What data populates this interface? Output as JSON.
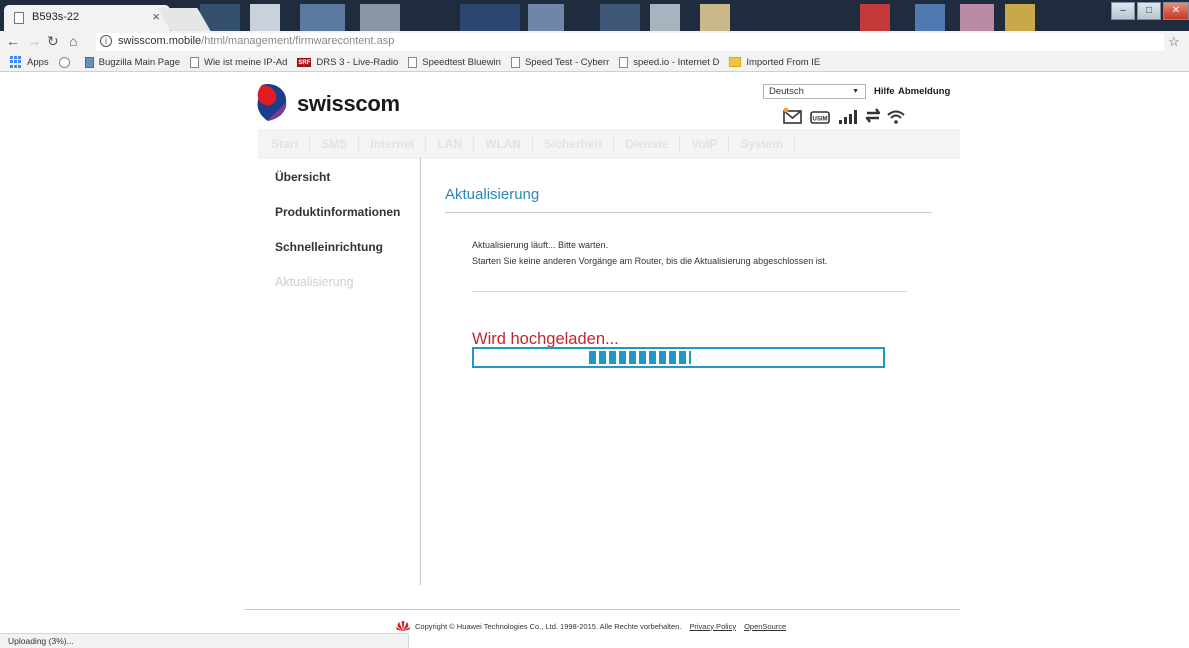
{
  "browser": {
    "tab_title": "B593s-22",
    "tab_close": "×",
    "url_host": "swisscom.mobile",
    "url_path": "/html/management/firmwarecontent.asp",
    "bookmarks": [
      {
        "label": "Apps",
        "icon": "apps-grid-icon"
      },
      {
        "label": "",
        "icon": "history-clock-icon"
      },
      {
        "label": "Bugzilla Main Page",
        "icon": "bugzilla-icon"
      },
      {
        "label": "Wie ist meine IP-Ad",
        "icon": "page-icon"
      },
      {
        "label": "DRS 3 - Live-Radio",
        "icon": "srf-icon"
      },
      {
        "label": "Speedtest Bluewin",
        "icon": "page-icon"
      },
      {
        "label": "Speed Test - Cyberr",
        "icon": "page-icon"
      },
      {
        "label": "speed.io - Internet D",
        "icon": "page-icon"
      },
      {
        "label": "Imported From IE",
        "icon": "folder-icon"
      }
    ],
    "srf_badge": "SRF",
    "status_text": "Uploading (3%)..."
  },
  "header": {
    "brand": "swisscom",
    "language": "Deutsch",
    "help": "Hilfe",
    "logout": "Abmeldung"
  },
  "nav": {
    "items": [
      "Start",
      "SMS",
      "Internet",
      "LAN",
      "WLAN",
      "Sicherheit",
      "Dienste",
      "VoIP",
      "System"
    ]
  },
  "sidebar": {
    "items": [
      "Übersicht",
      "Produktinformationen",
      "Schnelleinrichtung",
      "Aktualisierung"
    ]
  },
  "content": {
    "title": "Aktualisierung",
    "message_line1": "Aktualisierung läuft... Bitte warten.",
    "message_line2": "Starten Sie keine anderen Vorgänge am Router, bis die Aktualisierung abgeschlossen ist.",
    "upload_label": "Wird hochgeladen...",
    "progress_start": 0.28,
    "progress_end": 0.53
  },
  "footer": {
    "copyright": "Copyright © Huawei Technologies Co., Ltd. 1998-2015. Alle Rechte vorbehalten.",
    "privacy": "Privacy Policy",
    "opensource": "OpenSource"
  },
  "colors": {
    "accent_blue": "#2296c8",
    "upload_red": "#c0282f",
    "title_blue": "#2a87b9"
  }
}
